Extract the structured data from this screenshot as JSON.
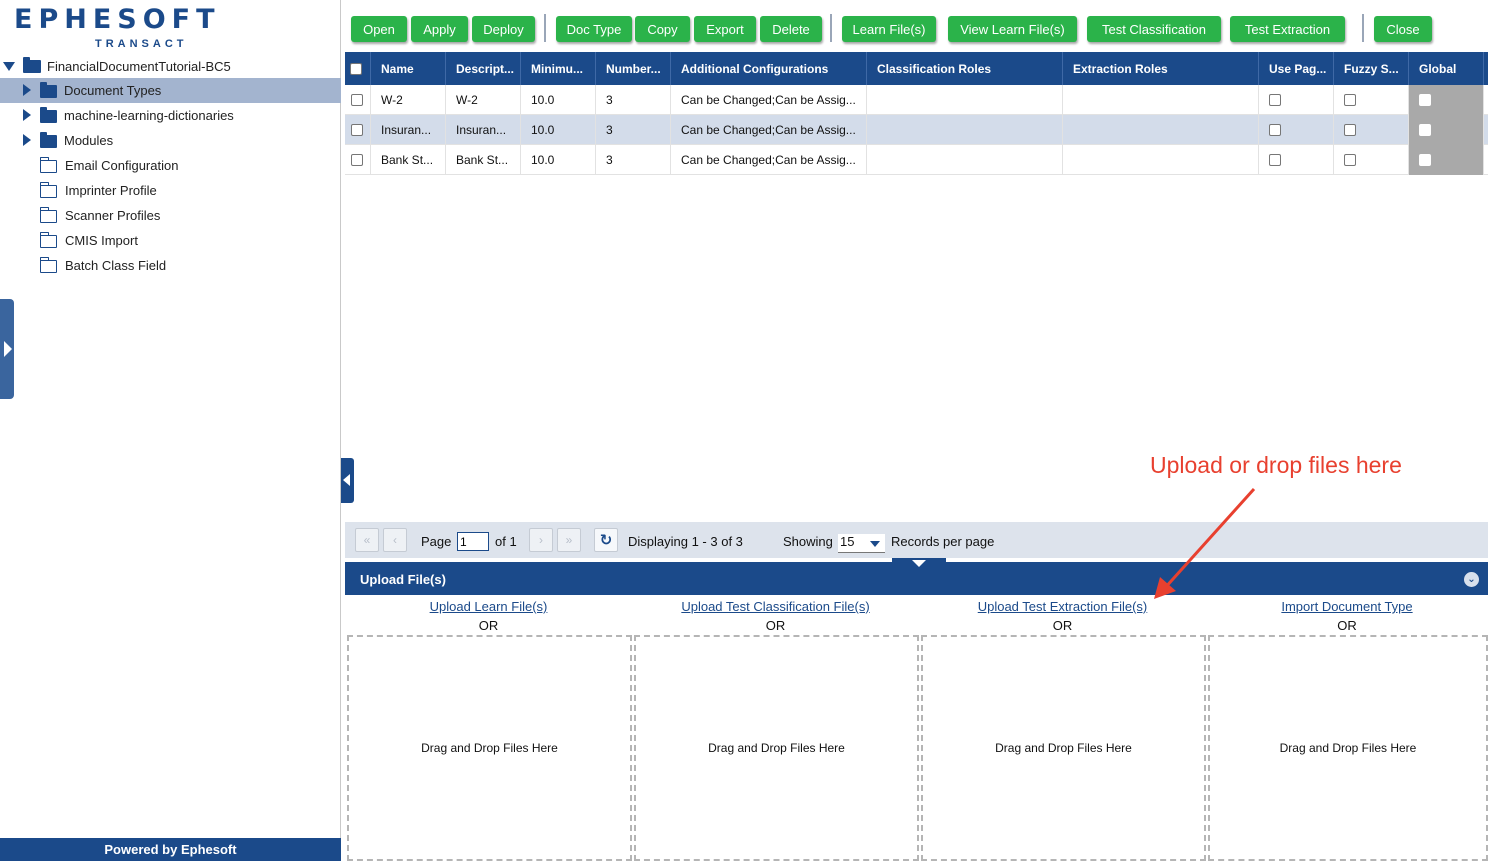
{
  "brand": {
    "logo_text": "EPHESOFT",
    "logo_sub": "TRANSACT",
    "color": "#1b4a8a",
    "powered_by": "Powered by Ephesoft"
  },
  "tree": {
    "root": "FinancialDocumentTutorial-BC5",
    "items": [
      {
        "label": "Document Types",
        "expandable": true,
        "selected": true
      },
      {
        "label": "machine-learning-dictionaries",
        "expandable": true
      },
      {
        "label": "Modules",
        "expandable": true
      },
      {
        "label": "Email Configuration"
      },
      {
        "label": "Imprinter Profile"
      },
      {
        "label": "Scanner Profiles"
      },
      {
        "label": "CMIS Import"
      },
      {
        "label": "Batch Class Field"
      }
    ]
  },
  "toolbar": {
    "open": "Open",
    "apply": "Apply",
    "deploy": "Deploy",
    "doc_type": "Doc Type",
    "copy": "Copy",
    "export": "Export",
    "delete": "Delete",
    "learn_files": "Learn File(s)",
    "view_learn_files": "View Learn File(s)",
    "test_classification": "Test Classification",
    "test_extraction": "Test Extraction",
    "close": "Close",
    "button_color": "#2bb34a"
  },
  "grid": {
    "columns": [
      "Name",
      "Descript...",
      "Minimu...",
      "Number...",
      "Additional Configurations",
      "Classification Roles",
      "Extraction Roles",
      "Use Pag...",
      "Fuzzy S...",
      "Global"
    ],
    "rows": [
      {
        "name": "W-2",
        "description": "W-2",
        "minimum": "10.0",
        "number": "3",
        "additional": "Can be Changed;Can be Assig..."
      },
      {
        "name": "Insuran...",
        "description": "Insuran...",
        "minimum": "10.0",
        "number": "3",
        "additional": "Can be Changed;Can be Assig..."
      },
      {
        "name": "Bank St...",
        "description": "Bank St...",
        "minimum": "10.0",
        "number": "3",
        "additional": "Can be Changed;Can be Assig..."
      }
    ]
  },
  "pager": {
    "page_label": "Page",
    "page_value": "1",
    "of_label": "of 1",
    "displaying": "Displaying 1 - 3 of 3",
    "showing": "Showing",
    "per_page_value": "15",
    "records_per_page": "Records per page"
  },
  "upload": {
    "title": "Upload File(s)",
    "columns": [
      {
        "link": "Upload Learn File(s)",
        "or": "OR",
        "drop": "Drag and Drop Files Here"
      },
      {
        "link": "Upload Test Classification File(s)",
        "or": "OR",
        "drop": "Drag and Drop Files Here"
      },
      {
        "link": "Upload Test Extraction File(s)",
        "or": "OR",
        "drop": "Drag and Drop Files Here"
      },
      {
        "link": "Import Document Type",
        "or": "OR",
        "drop": "Drag and Drop Files Here"
      }
    ]
  },
  "annotation": {
    "text": "Upload or drop files here",
    "color": "#e8402f"
  }
}
